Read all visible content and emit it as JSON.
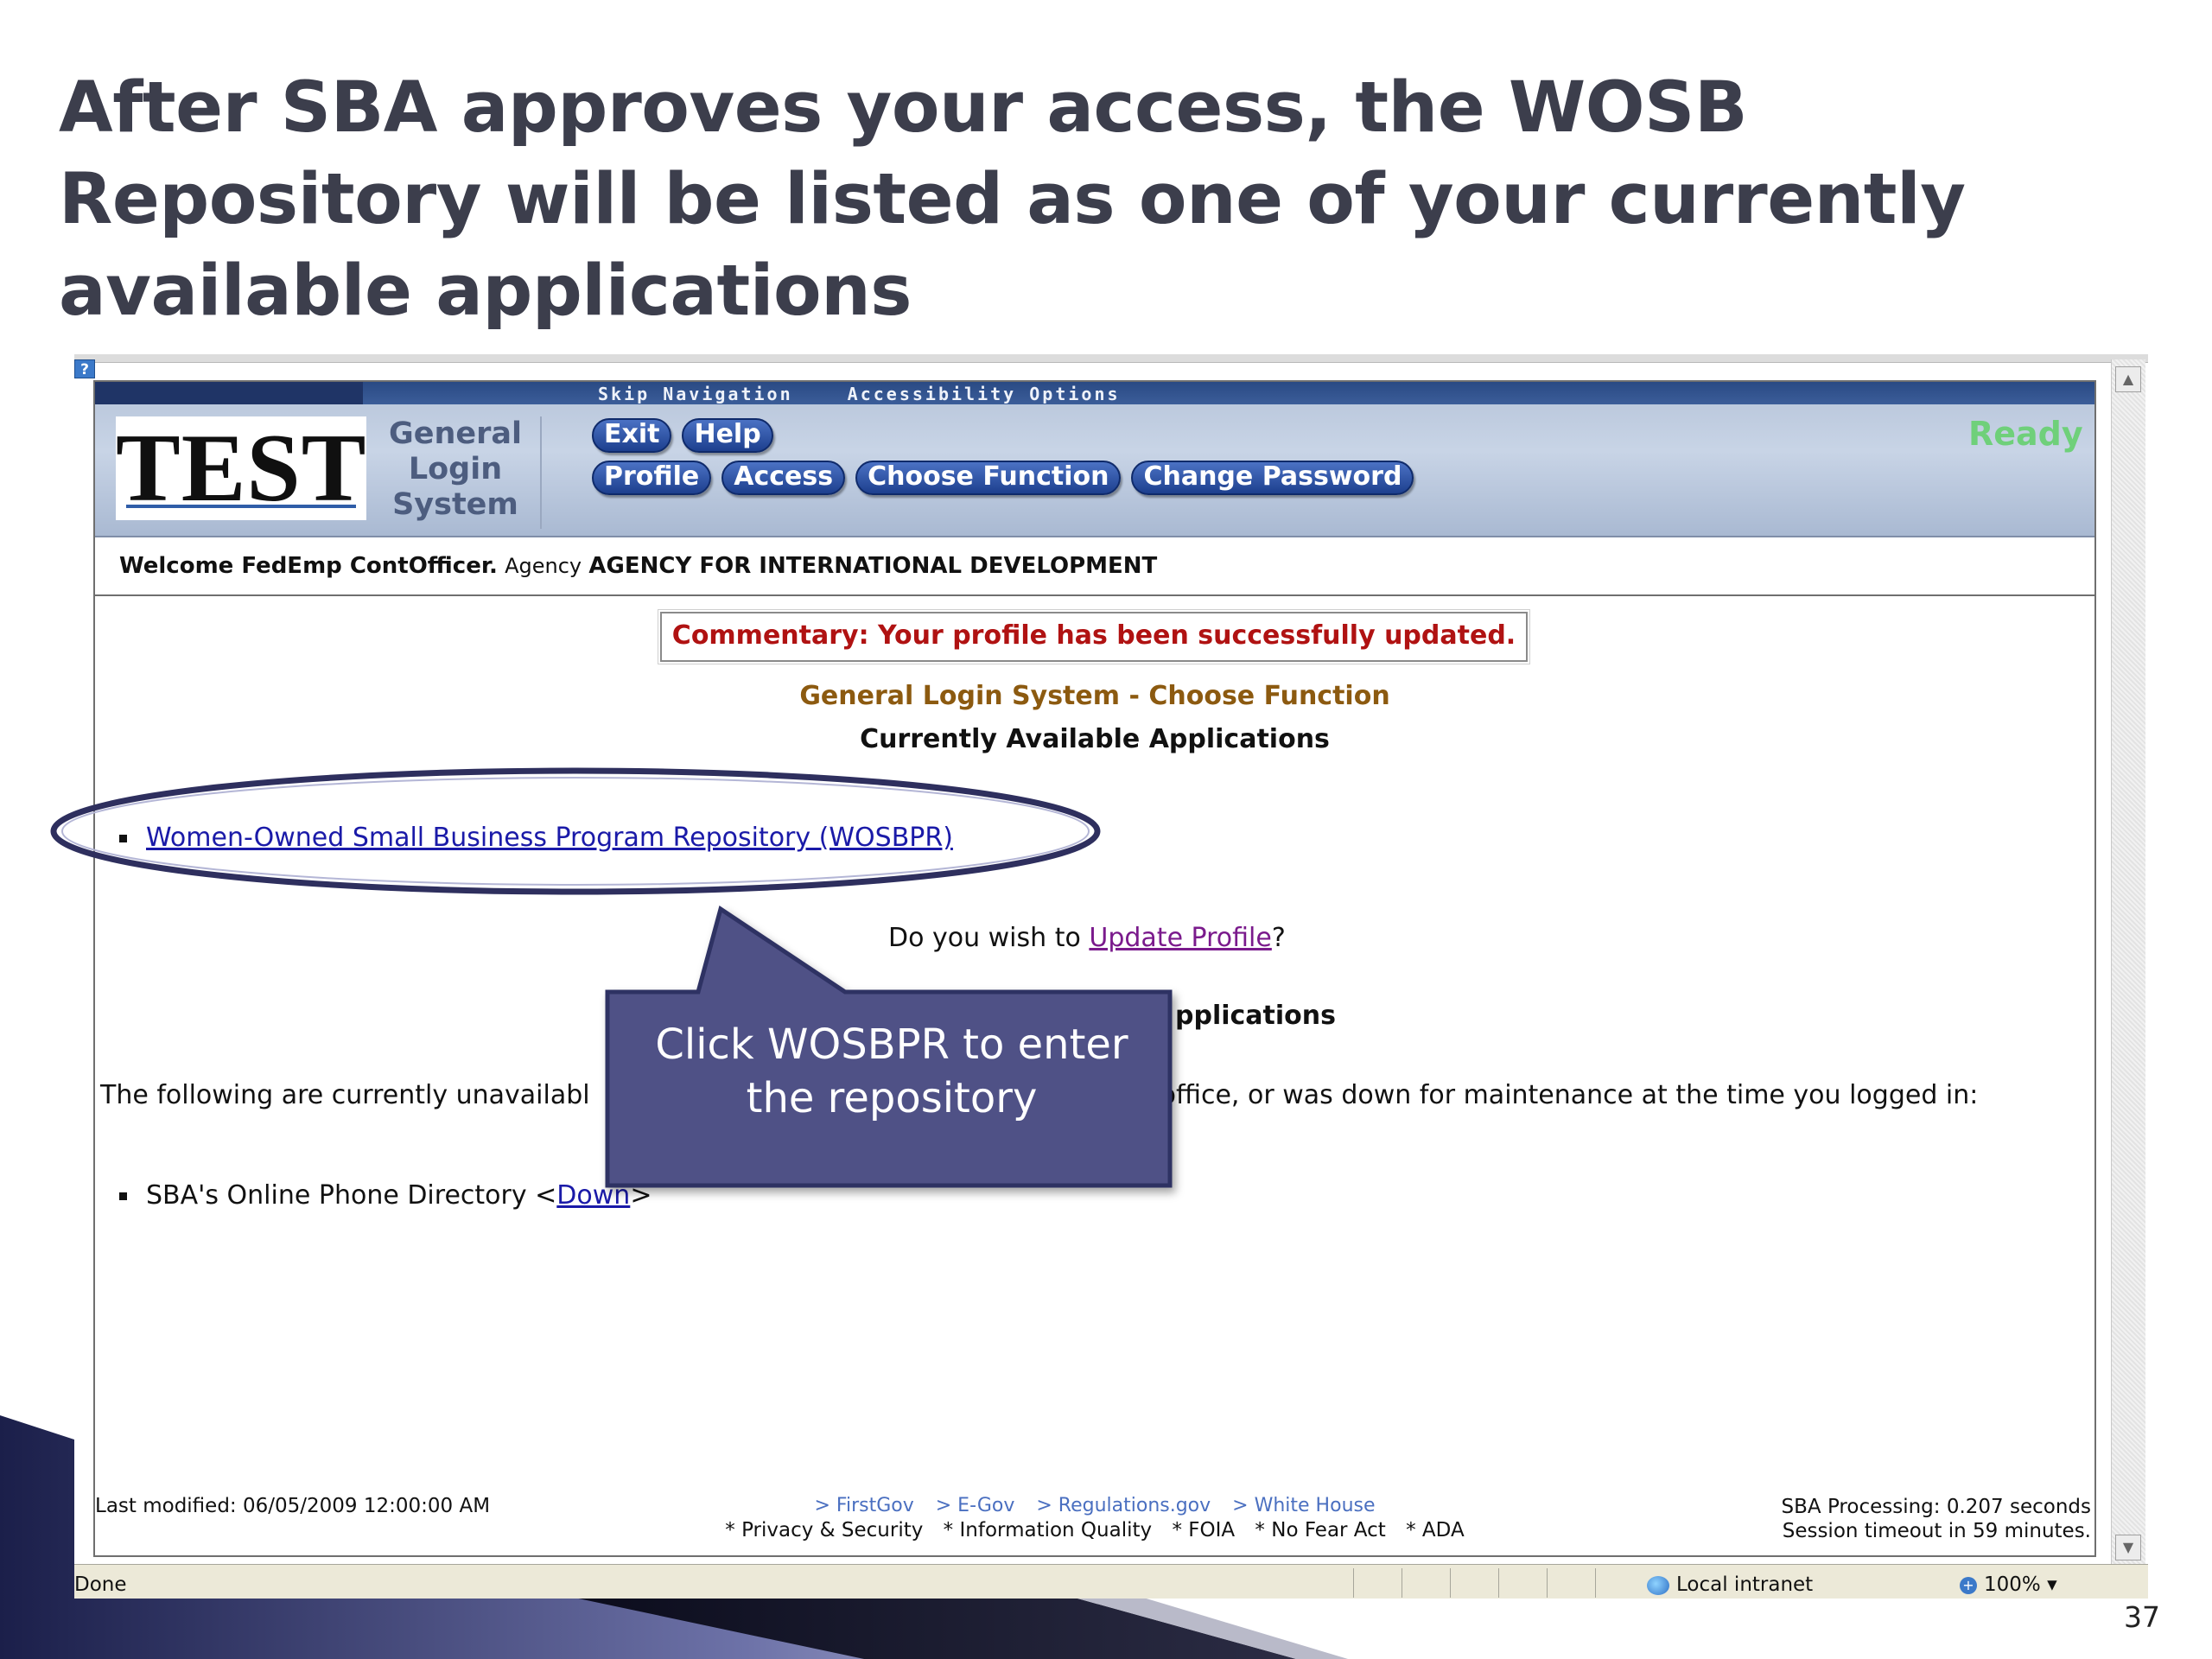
{
  "slide": {
    "title": "After SBA approves your access, the WOSB Repository will be listed as one of your currently available applications",
    "number": "37"
  },
  "gls": {
    "skip_navigation": "Skip Navigation",
    "accessibility_options": "Accessibility Options",
    "logo_text": "TEST",
    "system_name": [
      "General",
      "Login",
      "System"
    ],
    "nav_row1": [
      "Exit",
      "Help"
    ],
    "nav_row2": [
      "Profile",
      "Access",
      "Choose Function",
      "Change Password"
    ],
    "status": "Ready"
  },
  "welcome": {
    "greeting": "Welcome FedEmp ContOfficer.",
    "agency_label": "Agency",
    "agency": "AGENCY FOR INTERNATIONAL DEVELOPMENT"
  },
  "commentary": "Commentary: Your profile has been successfully updated.",
  "choose_function_title": "General Login System - Choose Function",
  "available": {
    "heading": "Currently Available Applications",
    "items": [
      "Women-Owned Small Business Program Repository (WOSBPR)"
    ]
  },
  "update_profile": {
    "prefix": "Do you wish to",
    "link": "Update Profile",
    "suffix": "?"
  },
  "unavailable": {
    "heading_visible": "pplications",
    "text_start": "The following are currently unavailabl",
    "text_end": "office, or was down for maintenance at the time you logged in:",
    "item_name": "SBA's Online Phone Directory",
    "item_status_open": "<",
    "item_status": "Down",
    "item_status_close": ">"
  },
  "footer": {
    "last_modified": "Last modified: 06/05/2009 12:00:00 AM",
    "links": [
      "> FirstGov",
      "> E-Gov",
      "> Regulations.gov",
      "> White House"
    ],
    "sublinks": [
      "* Privacy & Security",
      "* Information Quality",
      "* FOIA",
      "* No Fear Act",
      "* ADA"
    ],
    "processing": "SBA Processing:  0.207 seconds",
    "session": "Session timeout in 59 minutes."
  },
  "browser": {
    "status": "Done",
    "zone": "Local intranet",
    "zoom": "100%"
  },
  "callout": {
    "line1": "Click WOSBPR to enter",
    "line2": "the repository"
  },
  "colors": {
    "title": "#3c3e4c",
    "callout_fill": "#4f5186",
    "ellipse_stroke": "#2e2f5e",
    "commentary_red": "#b01212",
    "gls_gold": "#8c5a10",
    "link_blue": "#1a1aa8",
    "ready_green": "#6fd07a"
  }
}
